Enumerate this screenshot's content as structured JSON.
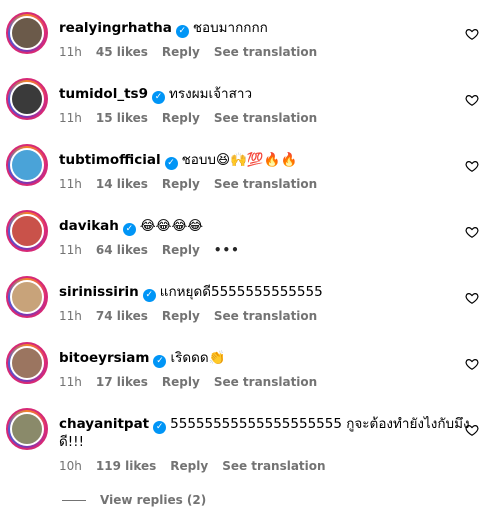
{
  "comments": [
    {
      "username": "realyingrhatha",
      "text": "ชอบมากกกก",
      "time": "11h",
      "likes": "45 likes",
      "reply": "Reply",
      "translate": "See translation",
      "avatar_color": "#6b5a4a"
    },
    {
      "username": "tumidol_ts9",
      "text": "ทรงผมเจ้าสาว",
      "time": "11h",
      "likes": "15 likes",
      "reply": "Reply",
      "translate": "See translation",
      "avatar_color": "#3a3a3a"
    },
    {
      "username": "tubtimofficial",
      "text": "ชอบบ😆🙌💯🔥🔥",
      "time": "11h",
      "likes": "14 likes",
      "reply": "Reply",
      "translate": "See translation",
      "avatar_color": "#4aa3d8"
    },
    {
      "username": "davikah",
      "text": "😂😂😂😂",
      "time": "11h",
      "likes": "64 likes",
      "reply": "Reply",
      "translate": "•••",
      "avatar_color": "#c9524a"
    },
    {
      "username": "sirinissirin",
      "text": "แกหยุดดี5555555555555",
      "time": "11h",
      "likes": "74 likes",
      "reply": "Reply",
      "translate": "See translation",
      "avatar_color": "#c8a37a"
    },
    {
      "username": "bitoeyrsiam",
      "text": "เริดดด👏",
      "time": "11h",
      "likes": "17 likes",
      "reply": "Reply",
      "translate": "See translation",
      "avatar_color": "#9b7560"
    },
    {
      "username": "chayanitpat",
      "text": "55555555555555555555 กูจะต้องทำยังไงกับมึง",
      "text2": "ดี!!!",
      "time": "10h",
      "likes": "119 likes",
      "reply": "Reply",
      "translate": "See translation",
      "avatar_color": "#8a8a6a"
    }
  ],
  "verified_mark": "✓",
  "view_replies": "View replies (2)",
  "colors": {
    "verified": "#0095f6",
    "meta": "#737373",
    "ring": "#d62976"
  }
}
